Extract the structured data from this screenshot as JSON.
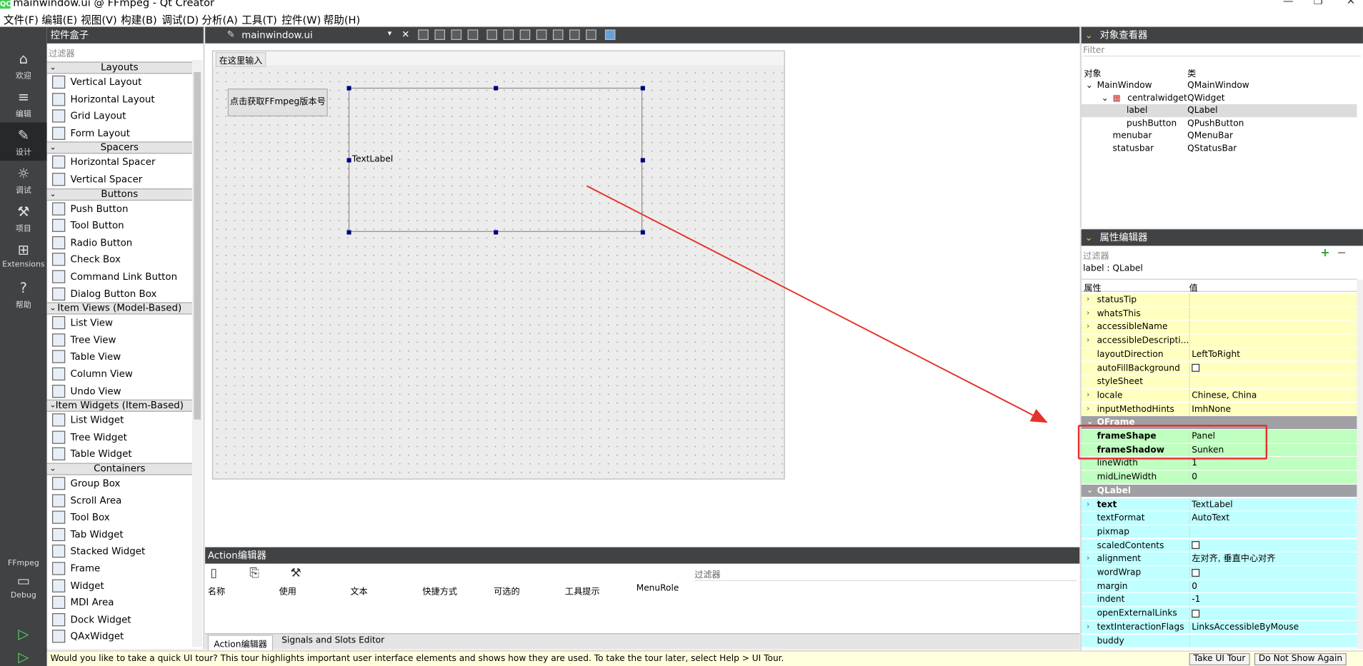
{
  "window": {
    "title": "mainwindow.ui @ FFmpeg - Qt Creator",
    "logo": "QC"
  },
  "menu": [
    "文件(F)",
    "编辑(E)",
    "视图(V)",
    "构建(B)",
    "调试(D)",
    "分析(A)",
    "工具(T)",
    "控件(W)",
    "帮助(H)"
  ],
  "modes": [
    {
      "label": "欢迎",
      "icon": "home-icon",
      "glyph": "⌂"
    },
    {
      "label": "编辑",
      "icon": "edit-icon",
      "glyph": "≡"
    },
    {
      "label": "设计",
      "icon": "design-icon",
      "glyph": "✎"
    },
    {
      "label": "调试",
      "icon": "debug-icon",
      "glyph": "☼"
    },
    {
      "label": "项目",
      "icon": "project-icon",
      "glyph": "⚒"
    },
    {
      "label": "Extensions",
      "icon": "extensions-icon",
      "glyph": "⊞"
    },
    {
      "label": "帮助",
      "icon": "help-icon",
      "glyph": "?"
    }
  ],
  "kit": {
    "name": "FFmpeg",
    "mode": "Debug"
  },
  "widgetbox": {
    "title": "控件盒子",
    "filter": "过滤器",
    "categories": [
      {
        "name": "Layouts",
        "items": [
          "Vertical Layout",
          "Horizontal Layout",
          "Grid Layout",
          "Form Layout"
        ]
      },
      {
        "name": "Spacers",
        "items": [
          "Horizontal Spacer",
          "Vertical Spacer"
        ]
      },
      {
        "name": "Buttons",
        "items": [
          "Push Button",
          "Tool Button",
          "Radio Button",
          "Check Box",
          "Command Link Button",
          "Dialog Button Box"
        ]
      },
      {
        "name": "Item Views (Model-Based)",
        "items": [
          "List View",
          "Tree View",
          "Table View",
          "Column View",
          "Undo View"
        ]
      },
      {
        "name": "Item Widgets (Item-Based)",
        "items": [
          "List Widget",
          "Tree Widget",
          "Table Widget"
        ]
      },
      {
        "name": "Containers",
        "items": [
          "Group Box",
          "Scroll Area",
          "Tool Box",
          "Tab Widget",
          "Stacked Widget",
          "Frame",
          "Widget",
          "MDI Area",
          "Dock Widget",
          "QAxWidget"
        ]
      }
    ]
  },
  "editor": {
    "filename": "mainwindow.ui",
    "close": "✕"
  },
  "form": {
    "menu_placeholder": "在这里输入",
    "button_text": "点击获取FFmpeg版本号",
    "label_text": "TextLabel"
  },
  "action_editor": {
    "title": "Action编辑器",
    "filter": "过滤器",
    "columns": [
      "名称",
      "使用",
      "文本",
      "快捷方式",
      "可选的",
      "工具提示",
      "MenuRole"
    ],
    "tabs": [
      "Action编辑器",
      "Signals and Slots Editor"
    ]
  },
  "tour": {
    "message": "Would you like to take a quick UI tour? This tour highlights important user interface elements and shows how they are used. To take the tour later, select Help > UI Tour.",
    "take": "Take UI Tour",
    "dismiss": "Do Not Show Again"
  },
  "object_inspector": {
    "title": "对象查看器",
    "filter": "Filter",
    "col_object": "对象",
    "col_class": "类",
    "rows": [
      {
        "name": "MainWindow",
        "cls": "QMainWindow"
      },
      {
        "name": "centralwidget",
        "cls": "QWidget"
      },
      {
        "name": "label",
        "cls": "QLabel"
      },
      {
        "name": "pushButton",
        "cls": "QPushButton"
      },
      {
        "name": "menubar",
        "cls": "QMenuBar"
      },
      {
        "name": "statusbar",
        "cls": "QStatusBar"
      }
    ]
  },
  "property_editor": {
    "title": "属性编辑器",
    "filter": "过滤器",
    "object": "label : QLabel",
    "col_prop": "属性",
    "col_val": "值",
    "rows": [
      {
        "name": "statusTip",
        "value": ""
      },
      {
        "name": "whatsThis",
        "value": ""
      },
      {
        "name": "accessibleName",
        "value": ""
      },
      {
        "name": "accessibleDescripti...",
        "value": ""
      },
      {
        "name": "layoutDirection",
        "value": "LeftToRight"
      },
      {
        "name": "autoFillBackground",
        "value": ""
      },
      {
        "name": "styleSheet",
        "value": ""
      },
      {
        "name": "locale",
        "value": "Chinese, China"
      },
      {
        "name": "inputMethodHints",
        "value": "ImhNone"
      },
      {
        "name": "QFrame",
        "value": ""
      },
      {
        "name": "frameShape",
        "value": "Panel"
      },
      {
        "name": "frameShadow",
        "value": "Sunken"
      },
      {
        "name": "lineWidth",
        "value": "1"
      },
      {
        "name": "midLineWidth",
        "value": "0"
      },
      {
        "name": "QLabel",
        "value": ""
      },
      {
        "name": "text",
        "value": "TextLabel"
      },
      {
        "name": "textFormat",
        "value": "AutoText"
      },
      {
        "name": "pixmap",
        "value": ""
      },
      {
        "name": "scaledContents",
        "value": ""
      },
      {
        "name": "alignment",
        "value": "左对齐, 垂直中心对齐"
      },
      {
        "name": "wordWrap",
        "value": ""
      },
      {
        "name": "margin",
        "value": "0"
      },
      {
        "name": "indent",
        "value": "-1"
      },
      {
        "name": "openExternalLinks",
        "value": ""
      },
      {
        "name": "textInteractionFlags",
        "value": "LinksAccessibleByMouse"
      },
      {
        "name": "buddy",
        "value": ""
      }
    ]
  },
  "colors": {
    "annotation": "#e53228",
    "dark": "#404244"
  }
}
